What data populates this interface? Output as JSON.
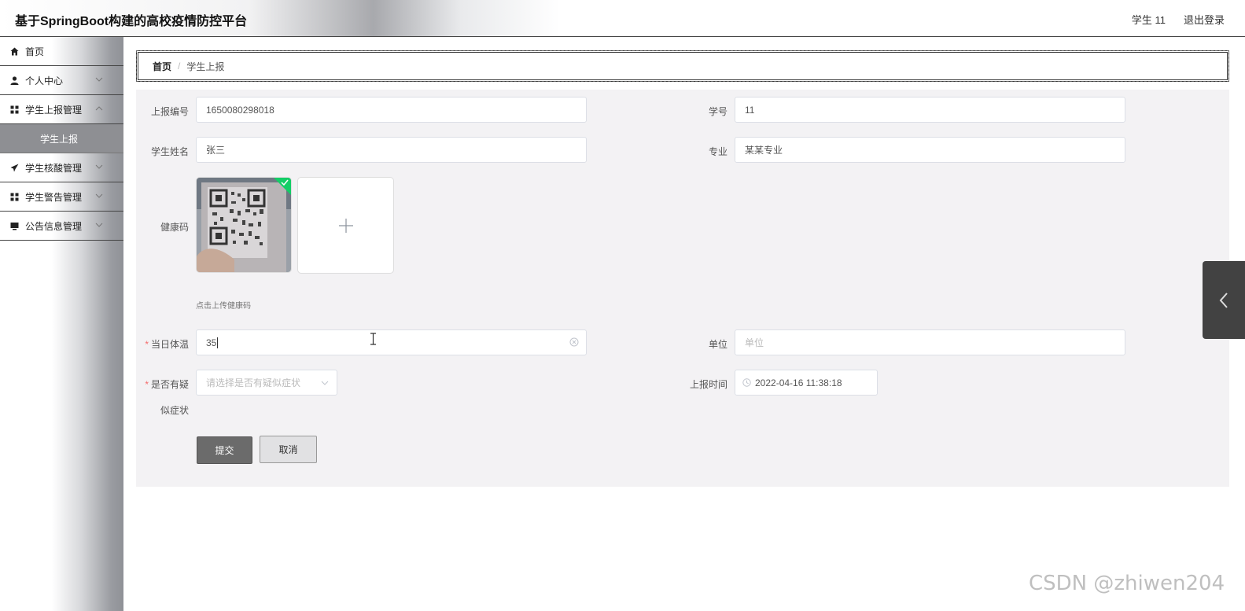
{
  "header": {
    "title": "基于SpringBoot构建的高校疫情防控平台",
    "user": "学生 11",
    "logout": "退出登录"
  },
  "sidebar": {
    "items": [
      {
        "label": "首页",
        "icon": "home-icon"
      },
      {
        "label": "个人中心",
        "icon": "user-icon"
      },
      {
        "label": "学生上报管理",
        "icon": "grid-icon"
      },
      {
        "label": "学生核酸管理",
        "icon": "send-icon"
      },
      {
        "label": "学生警告管理",
        "icon": "grid-icon"
      },
      {
        "label": "公告信息管理",
        "icon": "monitor-icon"
      }
    ],
    "active_sub": "学生上报"
  },
  "breadcrumb": {
    "home": "首页",
    "separator": "/",
    "current": "学生上报"
  },
  "form": {
    "report_no": {
      "label": "上报编号",
      "value": "1650080298018"
    },
    "student_id": {
      "label": "学号",
      "value": "11"
    },
    "student_name": {
      "label": "学生姓名",
      "value": "张三"
    },
    "major": {
      "label": "专业",
      "value": "某某专业"
    },
    "health_code": {
      "label": "健康码",
      "hint": "点击上传健康码"
    },
    "temperature": {
      "label": "当日体温",
      "value": "35"
    },
    "unit": {
      "label": "单位",
      "placeholder": "单位"
    },
    "symptom": {
      "label_line1": "是否有疑",
      "label_line2": "似症状",
      "placeholder": "请选择是否有疑似症状"
    },
    "report_time": {
      "label": "上报时间",
      "value": "2022-04-16 11:38:18"
    },
    "submit": "提交",
    "cancel": "取消"
  },
  "watermark": "CSDN @zhiwen204",
  "colors": {
    "submit_bg": "#6b6b6b",
    "active_menu_bg": "#8e8f93",
    "required": "#f56c6c",
    "upload_success": "#13ce66"
  }
}
